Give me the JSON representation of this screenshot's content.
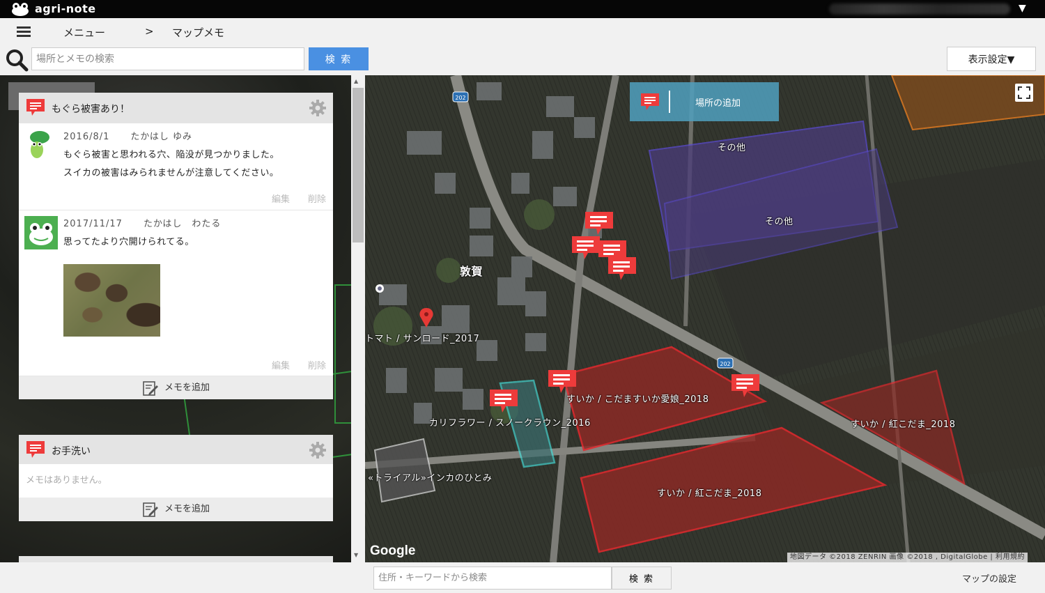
{
  "app": {
    "name": "agri-note"
  },
  "breadcrumb": {
    "menu": "メニュー",
    "separator": ">",
    "current": "マップメモ"
  },
  "search": {
    "placeholder": "場所とメモの検索",
    "button": "検 索",
    "display_settings": "表示設定▼"
  },
  "cards": [
    {
      "title": "もぐら被害あり！",
      "entries": [
        {
          "date": "2016/8/1",
          "author": "たかはし ゆみ",
          "lines": [
            "もぐら被害と思われる穴、陥没が見つかりました。",
            "スイカの被害はみられませんが注意してください。"
          ],
          "edit": "編集",
          "delete": "削除"
        },
        {
          "date": "2017/11/17",
          "author": "たかはし　わたる",
          "lines": [
            "思ってたより穴開けられてる。"
          ],
          "edit": "編集",
          "delete": "削除"
        }
      ],
      "add_memo": "メモを追加"
    },
    {
      "title": "お手洗い",
      "empty_text": "メモはありません。",
      "add_memo": "メモを追加"
    }
  ],
  "map": {
    "add_place": "場所の追加",
    "town": "敦賀",
    "route_number": "202",
    "labels": {
      "other1": "その他",
      "other2": "その他",
      "tomato": "トマト / サンロード_2017",
      "suika1": "すいか / こだますいか愛娘_2018",
      "suika2": "すいか / 紅こだま_2018",
      "suika3": "すいか / 紅こだま_2018",
      "cauliflower": "カリフラワー / スノークラウン_2016",
      "trial": "«トライアル»インカのひとみ"
    },
    "google": "Google",
    "attribution": "地図データ ©2018 ZENRIN 画像 ©2018 , DigitalGlobe | 利用規約"
  },
  "bottom": {
    "placeholder": "住所・キーワードから検索",
    "button": "検 索",
    "map_settings": "マップの設定"
  },
  "colors": {
    "accent": "#4a90e2",
    "memo_red": "#ee3b3b",
    "field_red": "#e5282d",
    "field_purple": "#5a4a9e"
  }
}
